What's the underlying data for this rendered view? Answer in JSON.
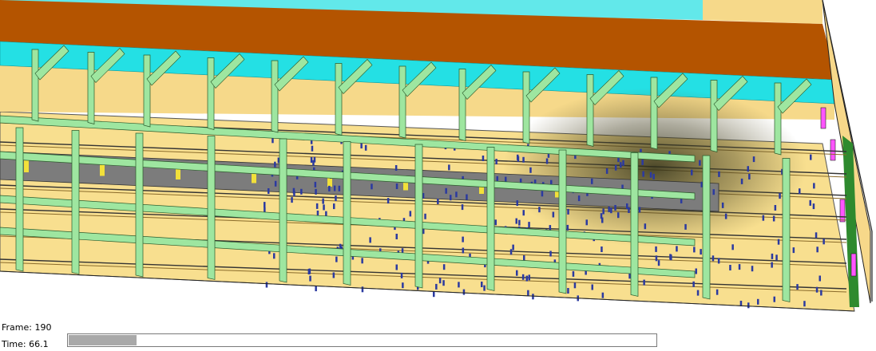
{
  "playback": {
    "frame_label": "Frame:",
    "frame_value": "190",
    "time_label": "Time:",
    "time_value": "66.1",
    "progress_fraction": 0.116
  },
  "scene": {
    "floor_color": "#f8df8f",
    "roof_color": "#b85400",
    "ceiling_band_color": "#26e2e6",
    "beam_color": "#9ee6a0",
    "train_color": "#7c7c7c",
    "door_color": "#ff55ff",
    "person_color": "#2b3aa0",
    "smoke_color": "#3a3a1e"
  }
}
